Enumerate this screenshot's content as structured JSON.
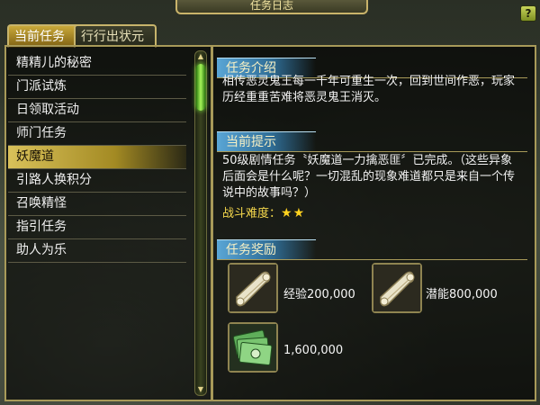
{
  "window": {
    "title": "任务日志",
    "help_label": "?"
  },
  "tabs": [
    {
      "label": "当前任务",
      "active": true
    },
    {
      "label": "行行出状元",
      "active": false
    }
  ],
  "quest_list": [
    {
      "label": "精精儿的秘密",
      "selected": false
    },
    {
      "label": "门派试炼",
      "selected": false
    },
    {
      "label": "日领取活动",
      "selected": false
    },
    {
      "label": "师门任务",
      "selected": false
    },
    {
      "label": "妖魔道",
      "selected": true
    },
    {
      "label": "引路人换积分",
      "selected": false
    },
    {
      "label": "召唤精怪",
      "selected": false
    },
    {
      "label": "指引任务",
      "selected": false
    },
    {
      "label": "助人为乐",
      "selected": false
    }
  ],
  "detail": {
    "intro_header": "任务介绍",
    "intro_text": "相传恶灵鬼王每一千年可重生一次，回到世间作恶，玩家历经重重苦难将恶灵鬼王消灭。",
    "hint_header": "当前提示",
    "hint_text": "50级剧情任务〝妖魔道一力擒恶匪〞已完成。（这些异象后面会是什么呢？一切混乱的现象难道都只是来自一个传说中的故事吗？）",
    "difficulty_label": "战斗难度：",
    "difficulty_stars": "★★",
    "difficulty_rating": 2,
    "reward_header": "任务奖励",
    "rewards": [
      {
        "icon": "scroll-icon",
        "label": "经验200,000"
      },
      {
        "icon": "scroll-icon",
        "label": "潜能800,000"
      },
      {
        "icon": "money-icon",
        "label": "1,600,000"
      }
    ]
  },
  "colors": {
    "selected_item": "#d9c15a",
    "section_header": "#5aa6d6",
    "difficulty_text": "#f5d84c",
    "border_gold": "#a89a59"
  }
}
